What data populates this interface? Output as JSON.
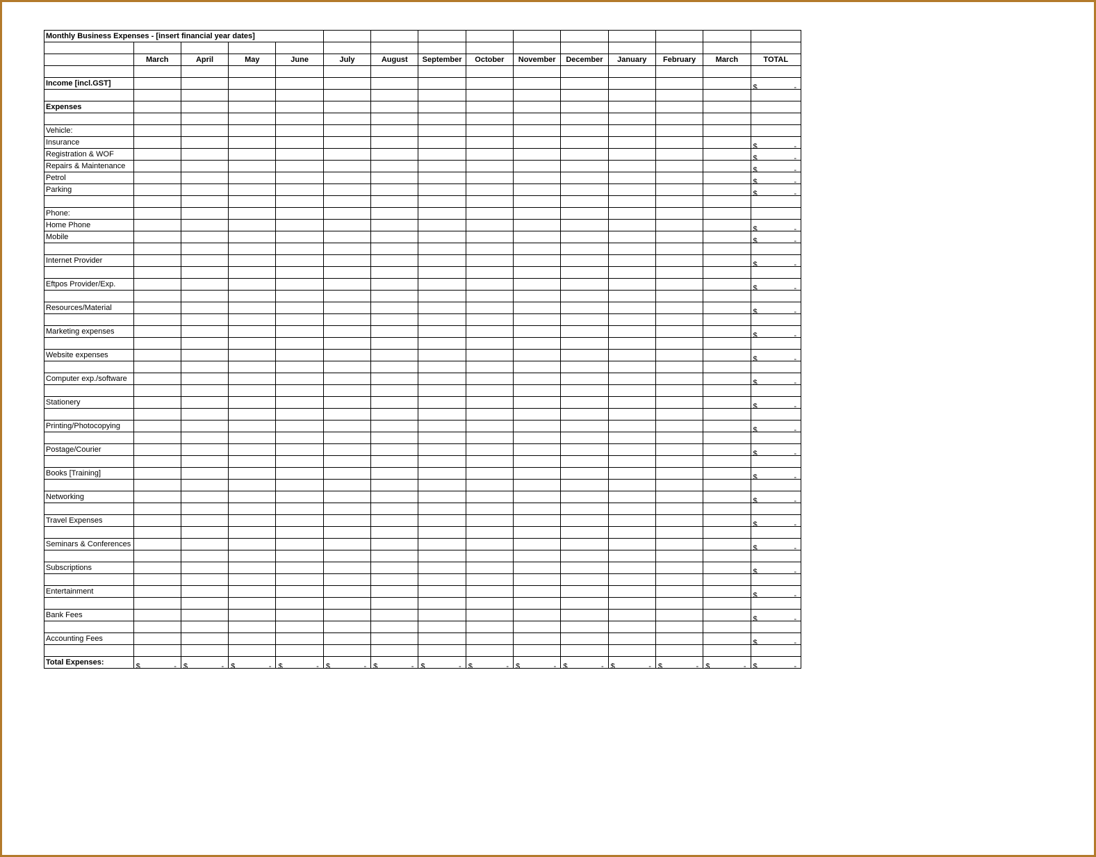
{
  "title": "Monthly Business Expenses - [insert financial year dates]",
  "months": [
    "March",
    "April",
    "May",
    "June",
    "July",
    "August",
    "September",
    "October",
    "November",
    "December",
    "January",
    "February",
    "March"
  ],
  "total_header": "TOTAL",
  "currency": "$",
  "dash": "-",
  "rows": [
    {
      "kind": "blank"
    },
    {
      "kind": "item",
      "label": "Income [incl.GST]",
      "bold": true,
      "total": true
    },
    {
      "kind": "blank"
    },
    {
      "kind": "item",
      "label": "Expenses",
      "bold": true,
      "total": false
    },
    {
      "kind": "blank"
    },
    {
      "kind": "item",
      "label": "Vehicle:",
      "bold": false,
      "total": false
    },
    {
      "kind": "item",
      "label": "Insurance",
      "indent": true,
      "total": true
    },
    {
      "kind": "item",
      "label": "Registration & WOF",
      "indent": true,
      "total": true
    },
    {
      "kind": "item",
      "label": "Repairs & Maintenance",
      "indent": true,
      "total": true
    },
    {
      "kind": "item",
      "label": "Petrol",
      "indent": true,
      "total": true
    },
    {
      "kind": "item",
      "label": "Parking",
      "indent": true,
      "total": true
    },
    {
      "kind": "blank"
    },
    {
      "kind": "item",
      "label": "Phone:",
      "total": false
    },
    {
      "kind": "item",
      "label": "Home Phone",
      "indent": true,
      "total": true
    },
    {
      "kind": "item",
      "label": "Mobile",
      "indent": true,
      "total": true
    },
    {
      "kind": "blank"
    },
    {
      "kind": "item",
      "label": "Internet Provider",
      "total": true
    },
    {
      "kind": "blank"
    },
    {
      "kind": "item",
      "label": "Eftpos Provider/Exp.",
      "total": true
    },
    {
      "kind": "blank"
    },
    {
      "kind": "item",
      "label": "Resources/Material",
      "total": true
    },
    {
      "kind": "blank"
    },
    {
      "kind": "item",
      "label": "Marketing expenses",
      "total": true
    },
    {
      "kind": "blank"
    },
    {
      "kind": "item",
      "label": "Website expenses",
      "total": true
    },
    {
      "kind": "blank"
    },
    {
      "kind": "item",
      "label": "Computer exp./software",
      "total": true
    },
    {
      "kind": "blank"
    },
    {
      "kind": "item",
      "label": "Stationery",
      "total": true
    },
    {
      "kind": "blank"
    },
    {
      "kind": "item",
      "label": "Printing/Photocopying",
      "total": true
    },
    {
      "kind": "blank"
    },
    {
      "kind": "item",
      "label": "Postage/Courier",
      "total": true
    },
    {
      "kind": "blank"
    },
    {
      "kind": "item",
      "label": "Books [Training]",
      "total": true
    },
    {
      "kind": "blank"
    },
    {
      "kind": "item",
      "label": "Networking",
      "total": true
    },
    {
      "kind": "blank"
    },
    {
      "kind": "item",
      "label": "Travel Expenses",
      "total": true
    },
    {
      "kind": "blank"
    },
    {
      "kind": "item",
      "label": "Seminars & Conferences",
      "total": true
    },
    {
      "kind": "blank"
    },
    {
      "kind": "item",
      "label": "Subscriptions",
      "total": true
    },
    {
      "kind": "blank"
    },
    {
      "kind": "item",
      "label": "Entertainment",
      "total": true
    },
    {
      "kind": "blank"
    },
    {
      "kind": "item",
      "label": "Bank Fees",
      "total": true
    },
    {
      "kind": "blank"
    },
    {
      "kind": "item",
      "label": "Accounting Fees",
      "total": true
    },
    {
      "kind": "blank"
    },
    {
      "kind": "item",
      "label": "Total Expenses:",
      "bold": true,
      "total": true,
      "month_totals": true
    }
  ]
}
